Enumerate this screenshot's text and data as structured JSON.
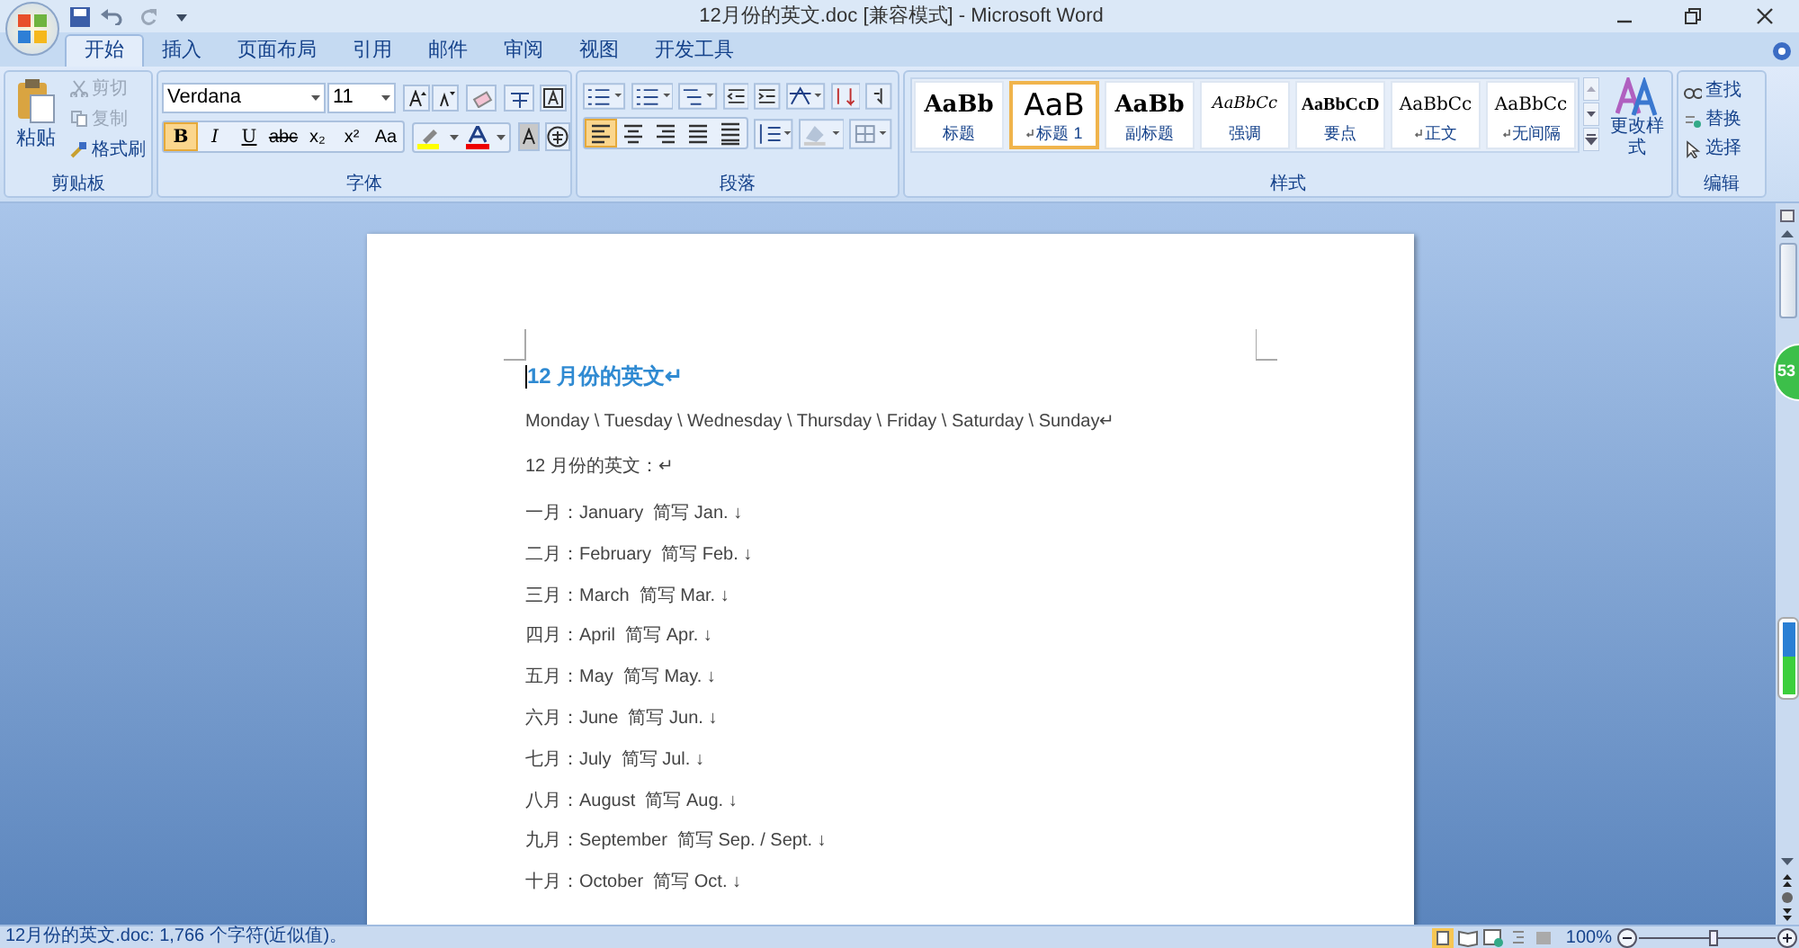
{
  "window": {
    "title": "12月份的英文.doc [兼容模式] - Microsoft Word"
  },
  "tabs": [
    {
      "label": "开始",
      "selected": true
    },
    {
      "label": "插入",
      "selected": false
    },
    {
      "label": "页面布局",
      "selected": false
    },
    {
      "label": "引用",
      "selected": false
    },
    {
      "label": "邮件",
      "selected": false
    },
    {
      "label": "审阅",
      "selected": false
    },
    {
      "label": "视图",
      "selected": false
    },
    {
      "label": "开发工具",
      "selected": false
    }
  ],
  "clipboard": {
    "paste": "粘贴",
    "group_label": "剪贴板",
    "items": [
      {
        "label": "剪切",
        "disabled": true
      },
      {
        "label": "复制",
        "disabled": true
      },
      {
        "label": "格式刷",
        "disabled": false
      }
    ]
  },
  "font": {
    "name": "Verdana",
    "size": "11",
    "group_label": "字体",
    "format_buttons": [
      {
        "label": "B",
        "selected": true
      },
      {
        "label": "I",
        "selected": false
      },
      {
        "label": "U",
        "selected": false
      },
      {
        "label": "abc",
        "selected": false
      },
      {
        "label": "x₂",
        "selected": false
      },
      {
        "label": "x²",
        "selected": false
      },
      {
        "label": "Aa",
        "selected": false
      }
    ]
  },
  "paragraph": {
    "group_label": "段落",
    "alignment": [
      {
        "selected": true
      },
      {
        "selected": false
      },
      {
        "selected": false
      },
      {
        "selected": false
      },
      {
        "selected": false
      }
    ]
  },
  "styles": {
    "group_label": "样式",
    "change": "更改样式",
    "items": [
      {
        "preview": "AaBb",
        "label": "标题",
        "mark": false,
        "selected": false,
        "kind": "bold"
      },
      {
        "preview": "AaB",
        "label": "标题 1",
        "mark": true,
        "selected": true,
        "kind": "large"
      },
      {
        "preview": "AaBb",
        "label": "副标题",
        "mark": false,
        "selected": false,
        "kind": "bold"
      },
      {
        "preview": "AaBbCc",
        "label": "强调",
        "mark": false,
        "selected": false,
        "kind": "italic"
      },
      {
        "preview": "AaBbCcD",
        "label": "要点",
        "mark": false,
        "selected": false,
        "kind": "strong"
      },
      {
        "preview": "AaBbCc",
        "label": "正文",
        "mark": true,
        "selected": false,
        "kind": "plain"
      },
      {
        "preview": "AaBbCc",
        "label": "无间隔",
        "mark": true,
        "selected": false,
        "kind": "plain"
      }
    ]
  },
  "editing": {
    "group_label": "编辑",
    "items": [
      "查找",
      "替换",
      "选择"
    ]
  },
  "document": {
    "heading": "12 月份的英文↵",
    "paragraphs": [
      "Monday \\ Tuesday \\ Wednesday \\ Thursday \\ Friday \\ Saturday \\ Sunday↵",
      "12 月份的英文：↵"
    ],
    "months": [
      "一月：January  简写 Jan. ↓",
      "二月：February  简写 Feb. ↓",
      "三月：March  简写 Mar. ↓",
      "四月：April  简写 Apr. ↓",
      "五月：May  简写 May. ↓",
      "六月：June  简写 Jun. ↓",
      "七月：July  简写 Jul. ↓",
      "八月：August  简写 Aug. ↓",
      "九月：September  简写 Sep. / Sept. ↓",
      "十月：October  简写 Oct. ↓"
    ]
  },
  "overlay_badge": {
    "text": "53"
  },
  "status_bar": {
    "text": "12月份的英文.doc: 1,766 个字符(近似值)。",
    "zoom": "100%",
    "level": 0.55
  }
}
